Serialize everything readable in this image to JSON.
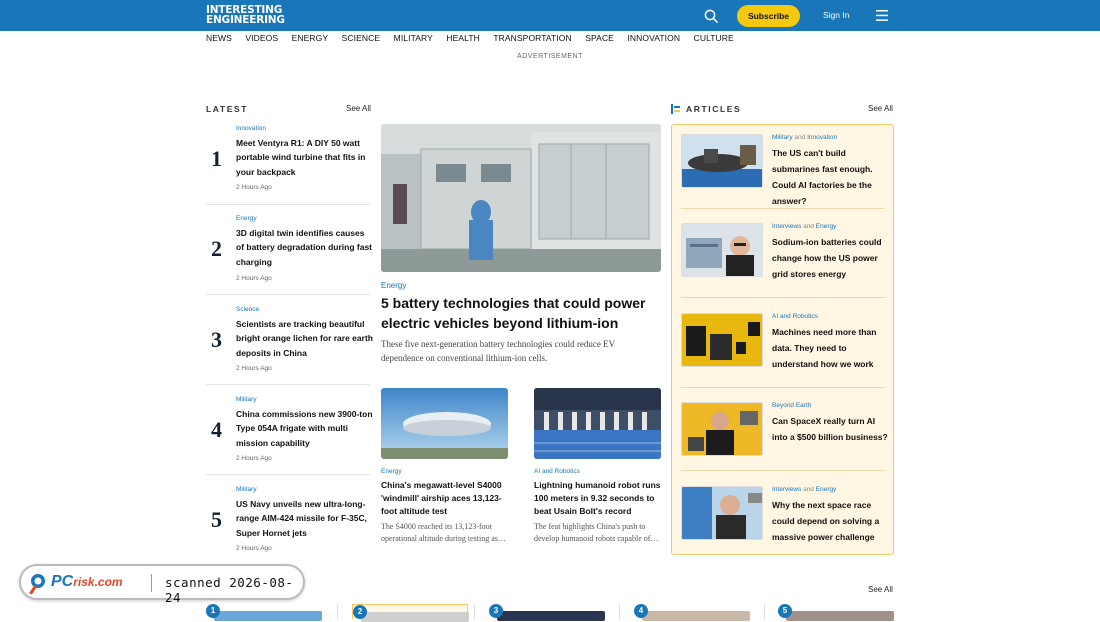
{
  "header": {
    "logo_line1": "INTERESTING",
    "logo_line2": "ENGINEERING",
    "subscribe_label": "Subscribe",
    "signin_label": "Sign In"
  },
  "nav": [
    "NEWS",
    "VIDEOS",
    "ENERGY",
    "SCIENCE",
    "MILITARY",
    "HEALTH",
    "TRANSPORTATION",
    "SPACE",
    "INNOVATION",
    "CULTURE"
  ],
  "advertisement_label": "ADVERTISEMENT",
  "latest": {
    "title": "LATEST",
    "see_all": "See All",
    "items": [
      {
        "num": "1",
        "category": "Innovation",
        "title": "Meet Ventyra R1: A DIY 50 watt portable wind turbine that fits in your backpack",
        "time": "2 Hours Ago"
      },
      {
        "num": "2",
        "category": "Energy",
        "title": "3D digital twin identifies causes of battery degradation during fast charging",
        "time": "2 Hours Ago"
      },
      {
        "num": "3",
        "category": "Science",
        "title": "Scientists are tracking beautiful bright orange lichen for rare earth deposits in China",
        "time": "2 Hours Ago"
      },
      {
        "num": "4",
        "category": "Military",
        "title": "China commissions new 3900-ton Type 054A frigate with multi mission capability",
        "time": "2 Hours Ago"
      },
      {
        "num": "5",
        "category": "Military",
        "title": "US Navy unveils new ultra-long-range AIM-424 missile for F-35C, Super Hornet jets",
        "time": "2 Hours Ago"
      }
    ]
  },
  "hero": {
    "category": "Energy",
    "title": "5 battery technologies that could power electric vehicles beyond lithium-ion",
    "description": "These five next-generation battery technologies could reduce EV dependence on conventional lithium-ion cells."
  },
  "cards": [
    {
      "category": "Energy",
      "title": "China's megawatt-level S4000 'windmill' airship aces 13,123-foot altitude test",
      "description": "The S4000 reached its 13,123-foot operational altitude during testing as…"
    },
    {
      "category": "AI and Robotics",
      "title": "Lightning humanoid robot runs 100 meters in 9.32 seconds to beat Usain Bolt's record",
      "description": "The feat highlights China's push to develop humanoid robots capable of…"
    }
  ],
  "articles": {
    "title": "ARTICLES",
    "see_all": "See All",
    "items": [
      {
        "cat1": "Military",
        "joiner": "and",
        "cat2": "Innovation",
        "title": "The US can't build submarines fast enough. Could AI factories be the answer?"
      },
      {
        "cat1": "Interviews",
        "joiner": "and",
        "cat2": "Energy",
        "title": "Sodium-ion batteries could change how the US power grid stores energy"
      },
      {
        "cat1": "AI and Robotics",
        "joiner": "",
        "cat2": "",
        "title": "Machines need more than data. They need to understand how we work"
      },
      {
        "cat1": "Beyond Earth",
        "joiner": "",
        "cat2": "",
        "title": "Can SpaceX really turn AI into a $500 billion business?"
      },
      {
        "cat1": "Interviews",
        "joiner": "and",
        "cat2": "Energy",
        "title": "Why the next space race could depend on solving a massive power challenge"
      }
    ]
  },
  "bottom": {
    "see_all": "See All",
    "badges": [
      "1",
      "2",
      "3",
      "4",
      "5"
    ]
  },
  "watermark": {
    "logo_main": "PC",
    "logo_sub": "risk.com",
    "text": "scanned 2026-08-24"
  },
  "colors": {
    "brand_blue": "#1976b8",
    "subscribe_yellow": "#f6c90e",
    "articles_bg": "#fff6e3"
  }
}
